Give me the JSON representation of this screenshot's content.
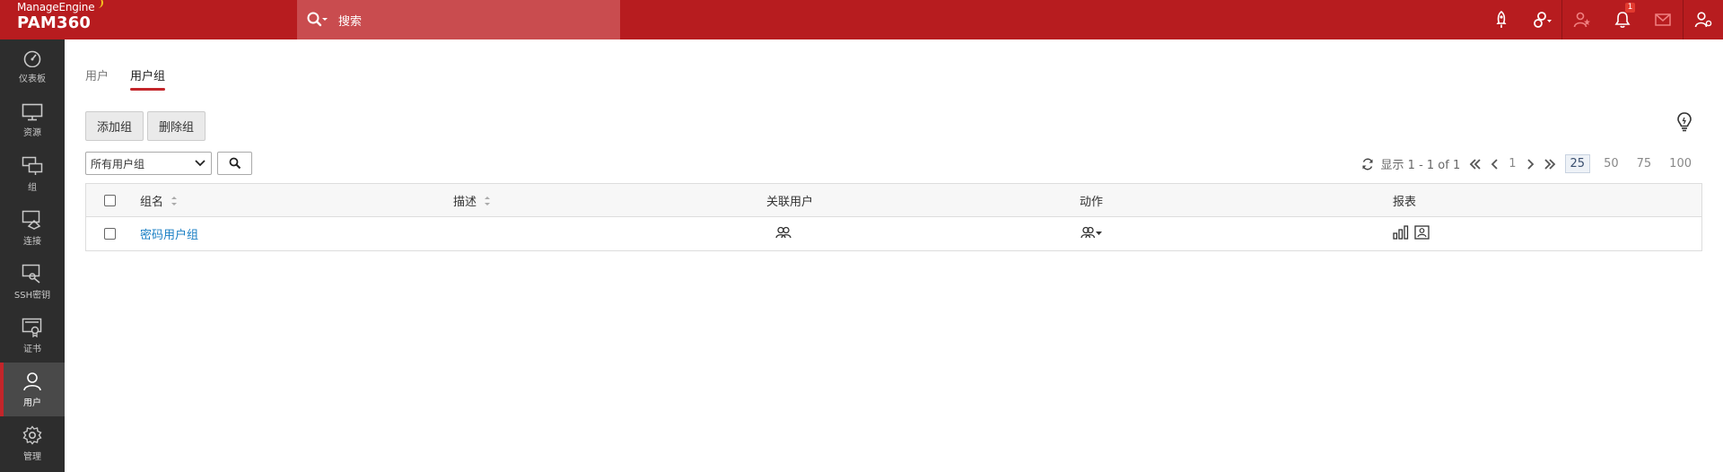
{
  "brand": {
    "top": "ManageEngine",
    "main": "PAM360"
  },
  "search": {
    "placeholder": "搜索"
  },
  "top_icons": [
    {
      "name": "rocket-icon"
    },
    {
      "name": "key-link-icon"
    },
    {
      "name": "user-star-icon"
    },
    {
      "name": "bell-icon",
      "badge": "1"
    },
    {
      "name": "mail-icon"
    },
    {
      "name": "user-settings-icon"
    }
  ],
  "sidebar": {
    "items": [
      {
        "label": "仪表板",
        "icon": "dashboard-icon"
      },
      {
        "label": "资源",
        "icon": "monitor-icon"
      },
      {
        "label": "组",
        "icon": "group-icon"
      },
      {
        "label": "连接",
        "icon": "connection-icon"
      },
      {
        "label": "SSH密钥",
        "icon": "ssh-key-icon"
      },
      {
        "label": "证书",
        "icon": "certificate-icon"
      },
      {
        "label": "用户",
        "icon": "user-icon",
        "active": true
      },
      {
        "label": "管理",
        "icon": "gear-icon"
      }
    ]
  },
  "tabs": [
    {
      "label": "用户"
    },
    {
      "label": "用户组",
      "active": true
    }
  ],
  "actions": {
    "add_group": "添加组",
    "delete_group": "删除组"
  },
  "filter": {
    "selected": "所有用户组"
  },
  "pager": {
    "display": "显示 1 - 1 of 1",
    "page": "1",
    "sizes": [
      "25",
      "50",
      "75",
      "100"
    ],
    "selected_size": "25"
  },
  "table": {
    "headers": {
      "name": "组名",
      "description": "描述",
      "associated_users": "关联用户",
      "actions": "动作",
      "reports": "报表"
    },
    "rows": [
      {
        "name": "密码用户组",
        "description": ""
      }
    ]
  },
  "colors": {
    "topbar": "#b71c1f",
    "sidebar": "#2d2d2d",
    "accent": "#c3252a",
    "link": "#1a7fc4"
  }
}
